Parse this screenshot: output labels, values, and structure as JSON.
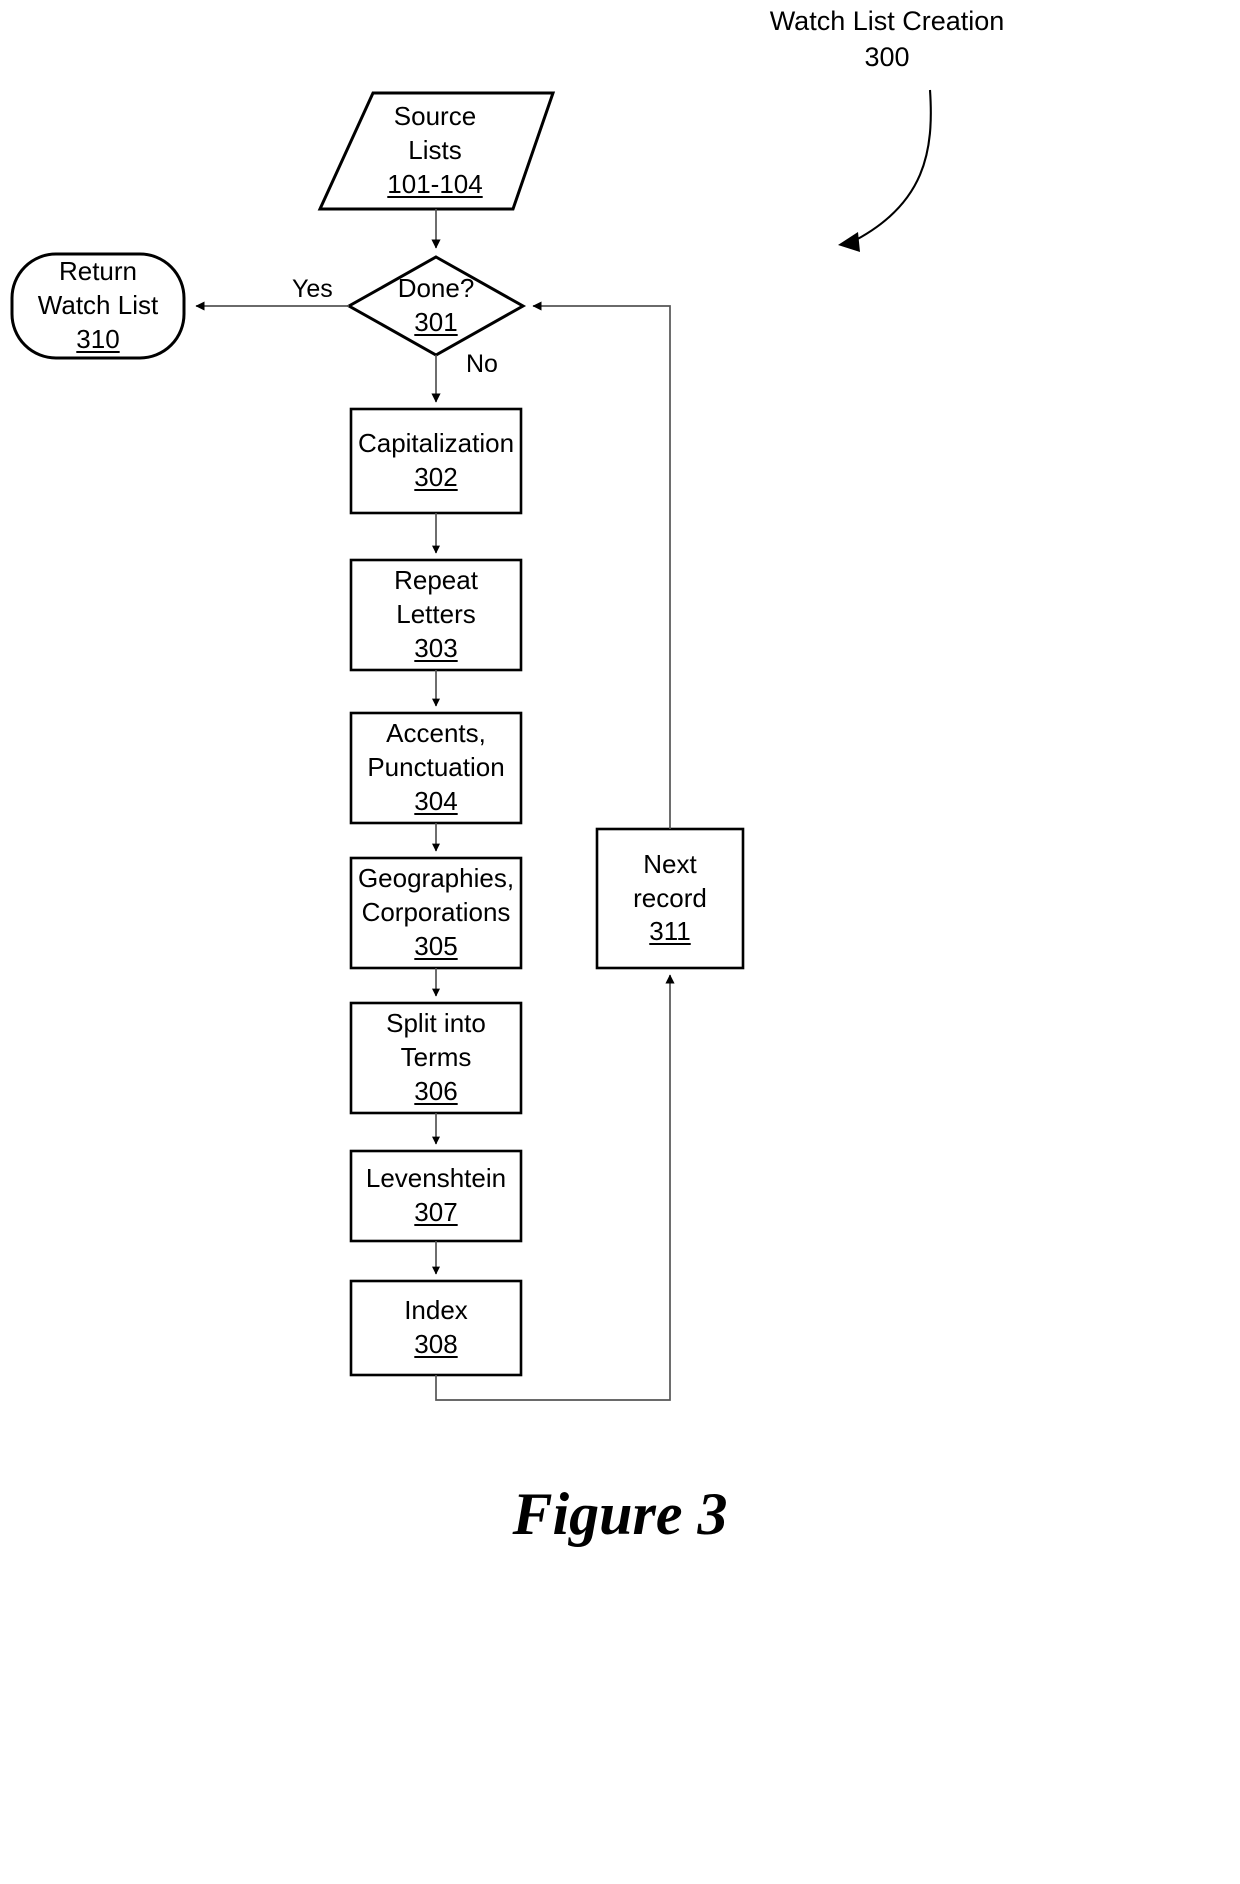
{
  "figure": {
    "caption": "Figure 3",
    "title_line1": "Watch List Creation",
    "title_line2": "300"
  },
  "nodes": {
    "source_lists": {
      "line1": "Source",
      "line2": "Lists",
      "ref": "101-104",
      "shape": "parallelogram"
    },
    "done": {
      "line1": "Done?",
      "ref": "301",
      "shape": "diamond"
    },
    "return_watch_list": {
      "line1": "Return",
      "line2": "Watch List",
      "ref": "310",
      "shape": "rounded-rect"
    },
    "capitalization": {
      "line1": "Capitalization",
      "ref": "302",
      "shape": "rect"
    },
    "repeat_letters": {
      "line1": "Repeat",
      "line2": "Letters",
      "ref": "303",
      "shape": "rect"
    },
    "accents_punctuation": {
      "line1": "Accents,",
      "line2": "Punctuation",
      "ref": "304",
      "shape": "rect"
    },
    "geographies_corporations": {
      "line1": "Geographies,",
      "line2": "Corporations",
      "ref": "305",
      "shape": "rect"
    },
    "split_into_terms": {
      "line1": "Split into",
      "line2": "Terms",
      "ref": "306",
      "shape": "rect"
    },
    "levenshtein": {
      "line1": "Levenshtein",
      "ref": "307",
      "shape": "rect"
    },
    "index": {
      "line1": "Index",
      "ref": "308",
      "shape": "rect"
    },
    "next_record": {
      "line1": "Next",
      "line2": "record",
      "ref": "311",
      "shape": "rect"
    }
  },
  "edges": {
    "yes_label": "Yes",
    "no_label": "No"
  },
  "colors": {
    "stroke": "#000000",
    "thin_stroke": "#4d4d4d",
    "background": "#ffffff",
    "text": "#000000"
  }
}
